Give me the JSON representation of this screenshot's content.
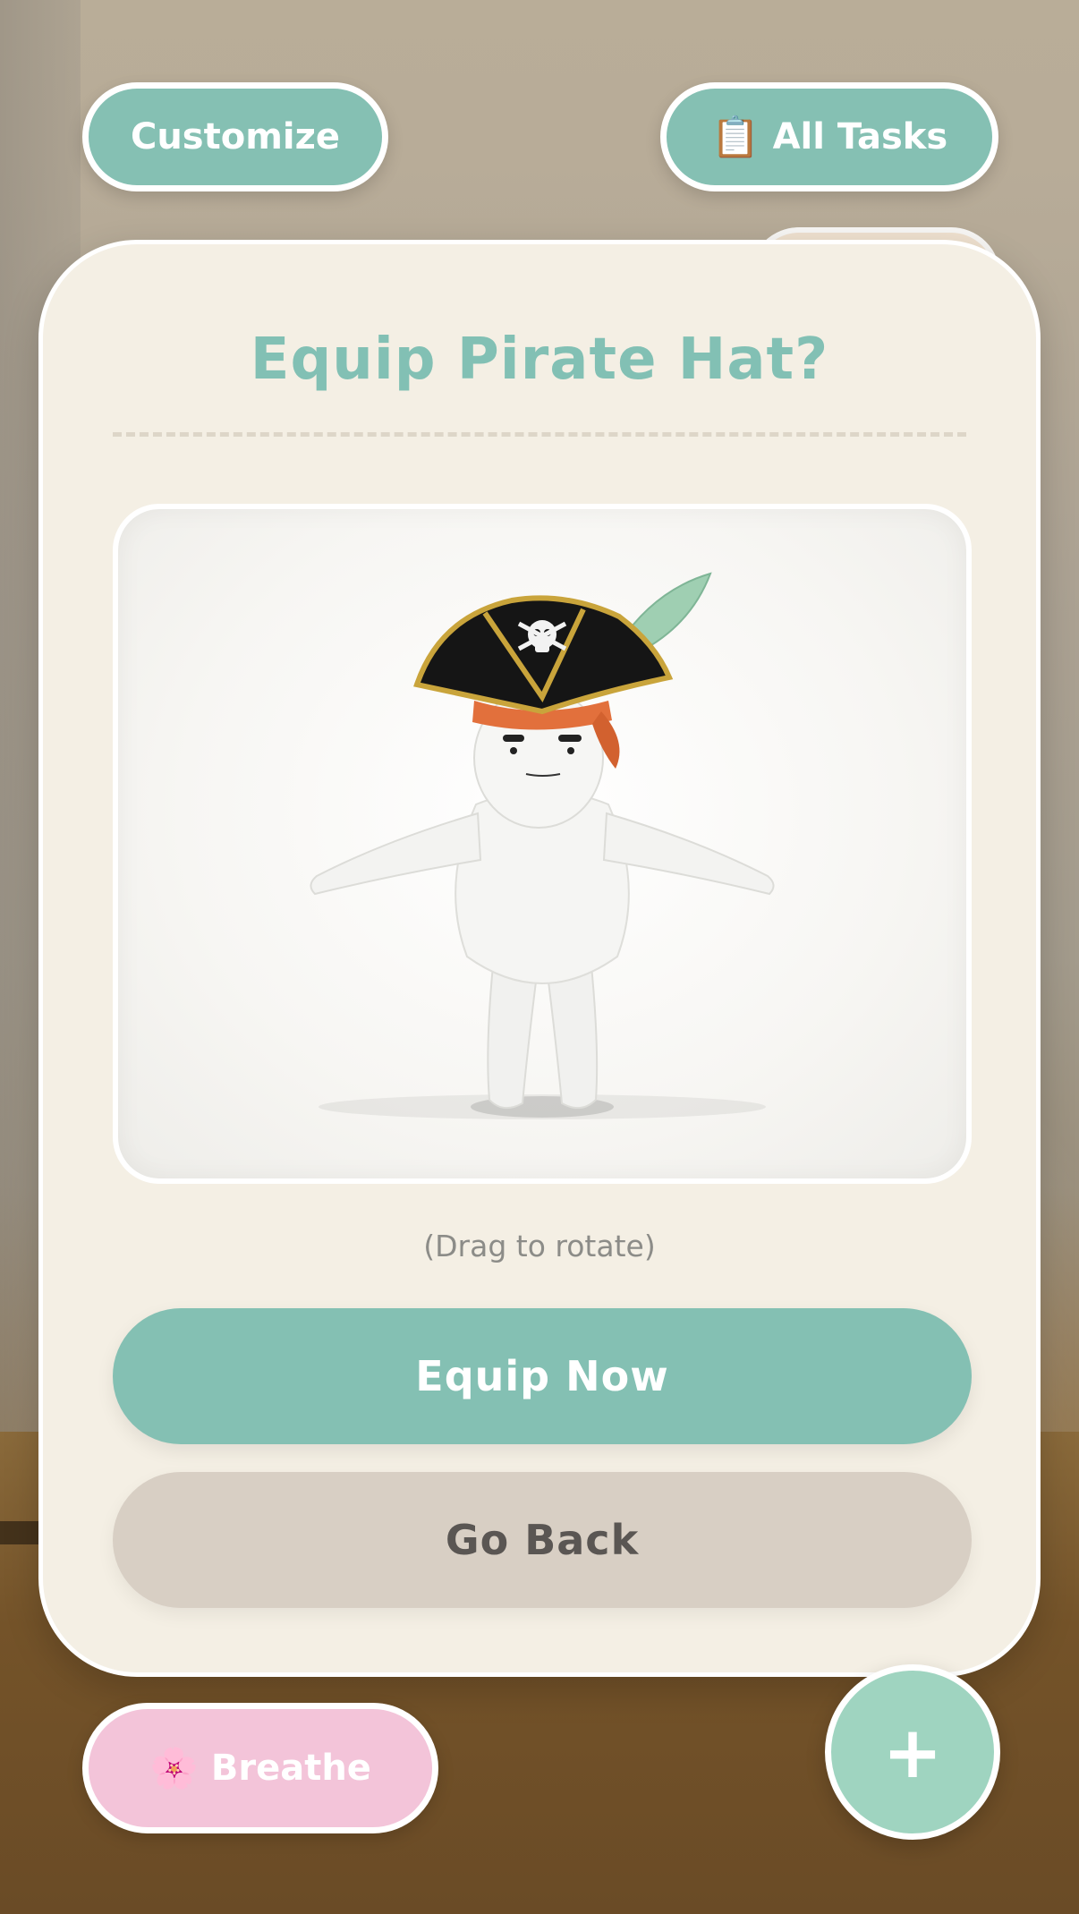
{
  "top_bar": {
    "customize_label": "Customize",
    "all_tasks_icon": "📋",
    "all_tasks_label": "All Tasks"
  },
  "dialog": {
    "title": "Equip Pirate Hat?",
    "preview_hint": "(Drag to rotate)",
    "equip_label": "Equip Now",
    "back_label": "Go Back"
  },
  "bottom_bar": {
    "breathe_icon": "🌸",
    "breathe_label": "Breathe",
    "fab_label": "+"
  },
  "colors": {
    "accent_teal": "#85c0b3",
    "pink": "#f3c4d9",
    "card_bg": "#f4efe4",
    "secondary_button": "#d8cfc4"
  }
}
